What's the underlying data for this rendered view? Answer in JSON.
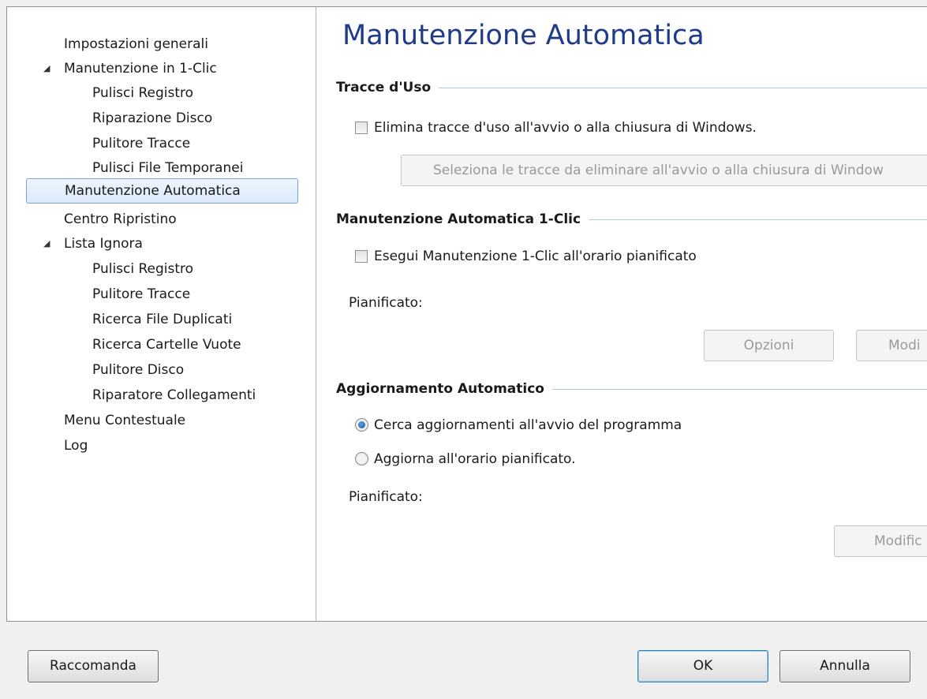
{
  "sidebar": {
    "items": [
      {
        "label": "Impostazioni generali"
      },
      {
        "label": "Manutenzione in 1-Clic"
      },
      {
        "label": "Pulisci Registro"
      },
      {
        "label": "Riparazione Disco"
      },
      {
        "label": "Pulitore Tracce"
      },
      {
        "label": "Pulisci File Temporanei"
      },
      {
        "label": "Manutenzione Automatica"
      },
      {
        "label": "Centro Ripristino"
      },
      {
        "label": "Lista Ignora"
      },
      {
        "label": "Pulisci Registro"
      },
      {
        "label": "Pulitore Tracce"
      },
      {
        "label": "Ricerca File Duplicati"
      },
      {
        "label": "Ricerca Cartelle Vuote"
      },
      {
        "label": "Pulitore Disco"
      },
      {
        "label": "Riparatore Collegamenti"
      },
      {
        "label": "Menu Contestuale"
      },
      {
        "label": "Log"
      }
    ]
  },
  "main": {
    "title": "Manutenzione Automatica",
    "traces": {
      "heading": "Tracce d'Uso",
      "checkbox_label": "Elimina tracce d'uso all'avvio o alla chiusura di Windows.",
      "checkbox_checked": false,
      "select_button": "Seleziona le tracce da eliminare all'avvio o alla chiusura di Window"
    },
    "auto1click": {
      "heading": "Manutenzione Automatica 1-Clic",
      "checkbox_label": "Esegui Manutenzione 1-Clic all'orario pianificato",
      "checkbox_checked": false,
      "scheduled_label": "Pianificato:",
      "options_button": "Opzioni",
      "modify_button": "Modi"
    },
    "autoupdate": {
      "heading": "Aggiornamento Automatico",
      "radio1_label": "Cerca aggiornamenti all'avvio del programma",
      "radio2_label": "Aggiorna all'orario pianificato.",
      "selected_radio": 1,
      "scheduled_label": "Pianificato:",
      "modify_button": "Modific"
    }
  },
  "footer": {
    "recommend_button": "Raccomanda",
    "ok_button": "OK",
    "cancel_button": "Annulla"
  }
}
